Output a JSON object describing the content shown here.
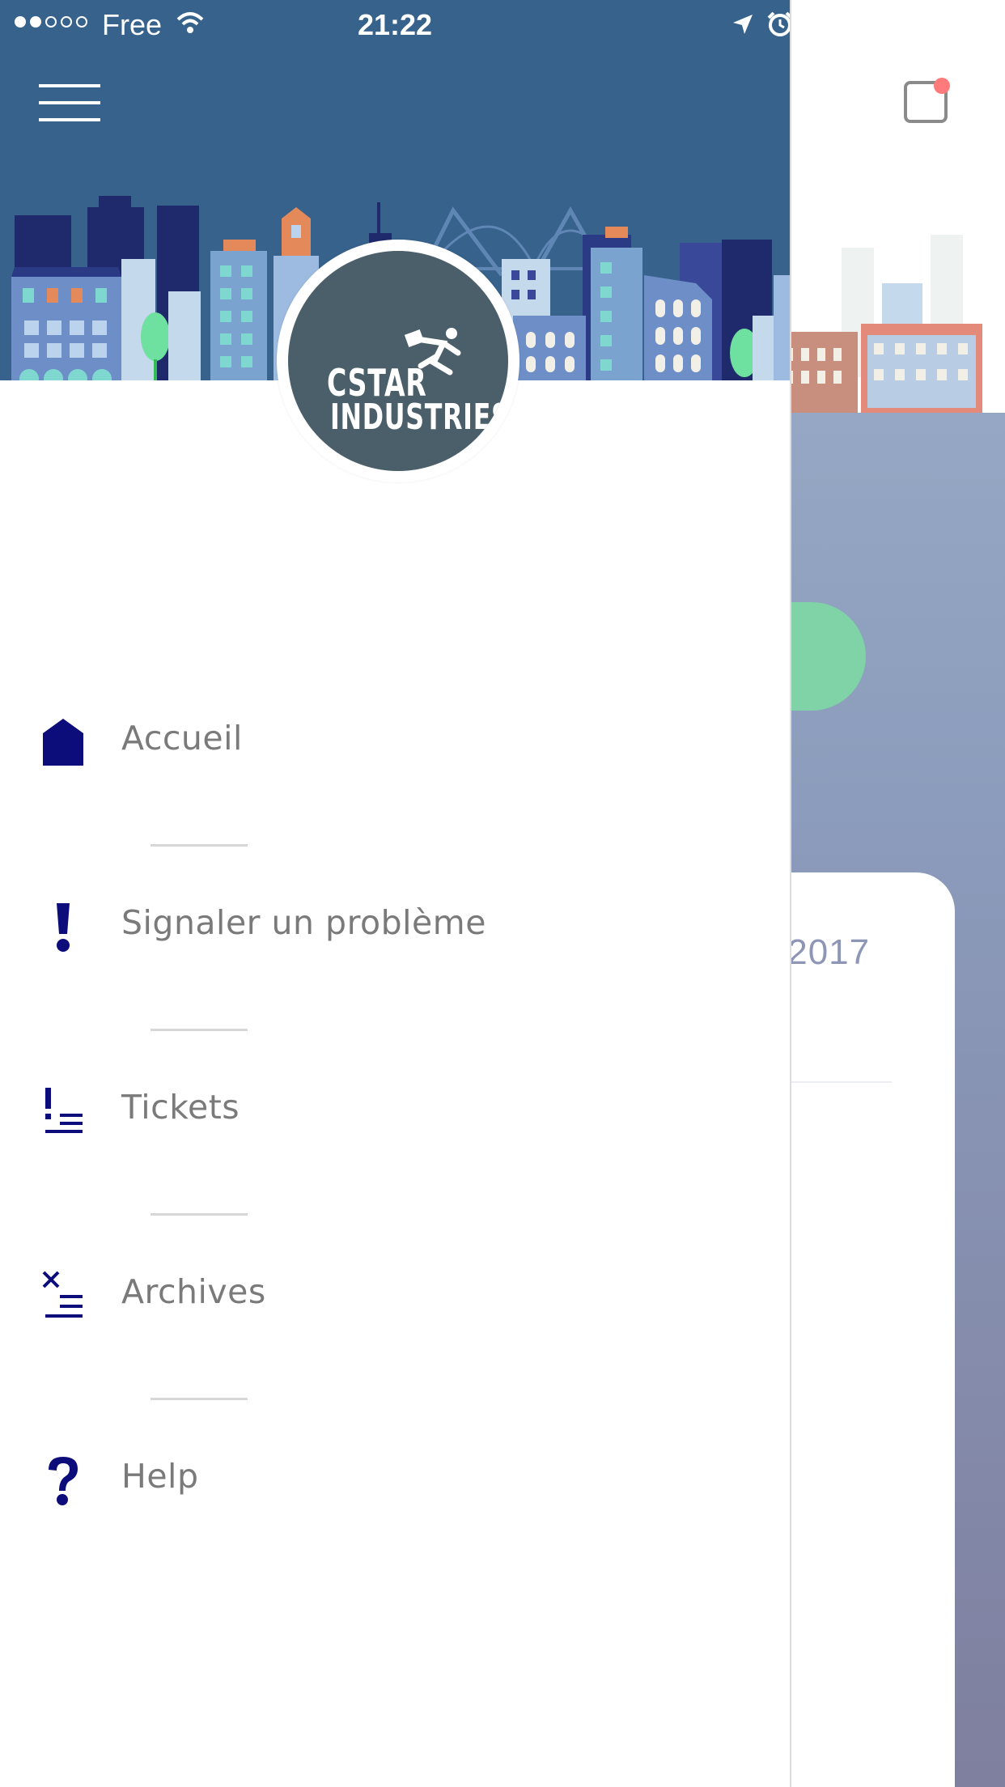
{
  "status_bar": {
    "carrier": "Free",
    "time": "21:22",
    "signal_dots_on": 2,
    "signal_dots_total": 5
  },
  "logo": {
    "line1": "CSTAR",
    "line2": "INDUSTRIES"
  },
  "menu": {
    "items": [
      {
        "label": "Accueil",
        "icon": "home-icon"
      },
      {
        "label": "Signaler un problème",
        "icon": "exclamation-icon"
      },
      {
        "label": "Tickets",
        "icon": "tickets-list-icon"
      },
      {
        "label": "Archives",
        "icon": "archives-list-icon"
      },
      {
        "label": "Help",
        "icon": "question-icon"
      }
    ]
  },
  "background_screen": {
    "date_fragment": "/2017"
  },
  "colors": {
    "header_bg": "#37628c",
    "icon_navy": "#0c0c7a",
    "menu_text": "#7a7a7a",
    "green_pill": "#7fd3a6",
    "notification_dot": "#ff7a7a",
    "logo_bg": "#4a5f69"
  }
}
